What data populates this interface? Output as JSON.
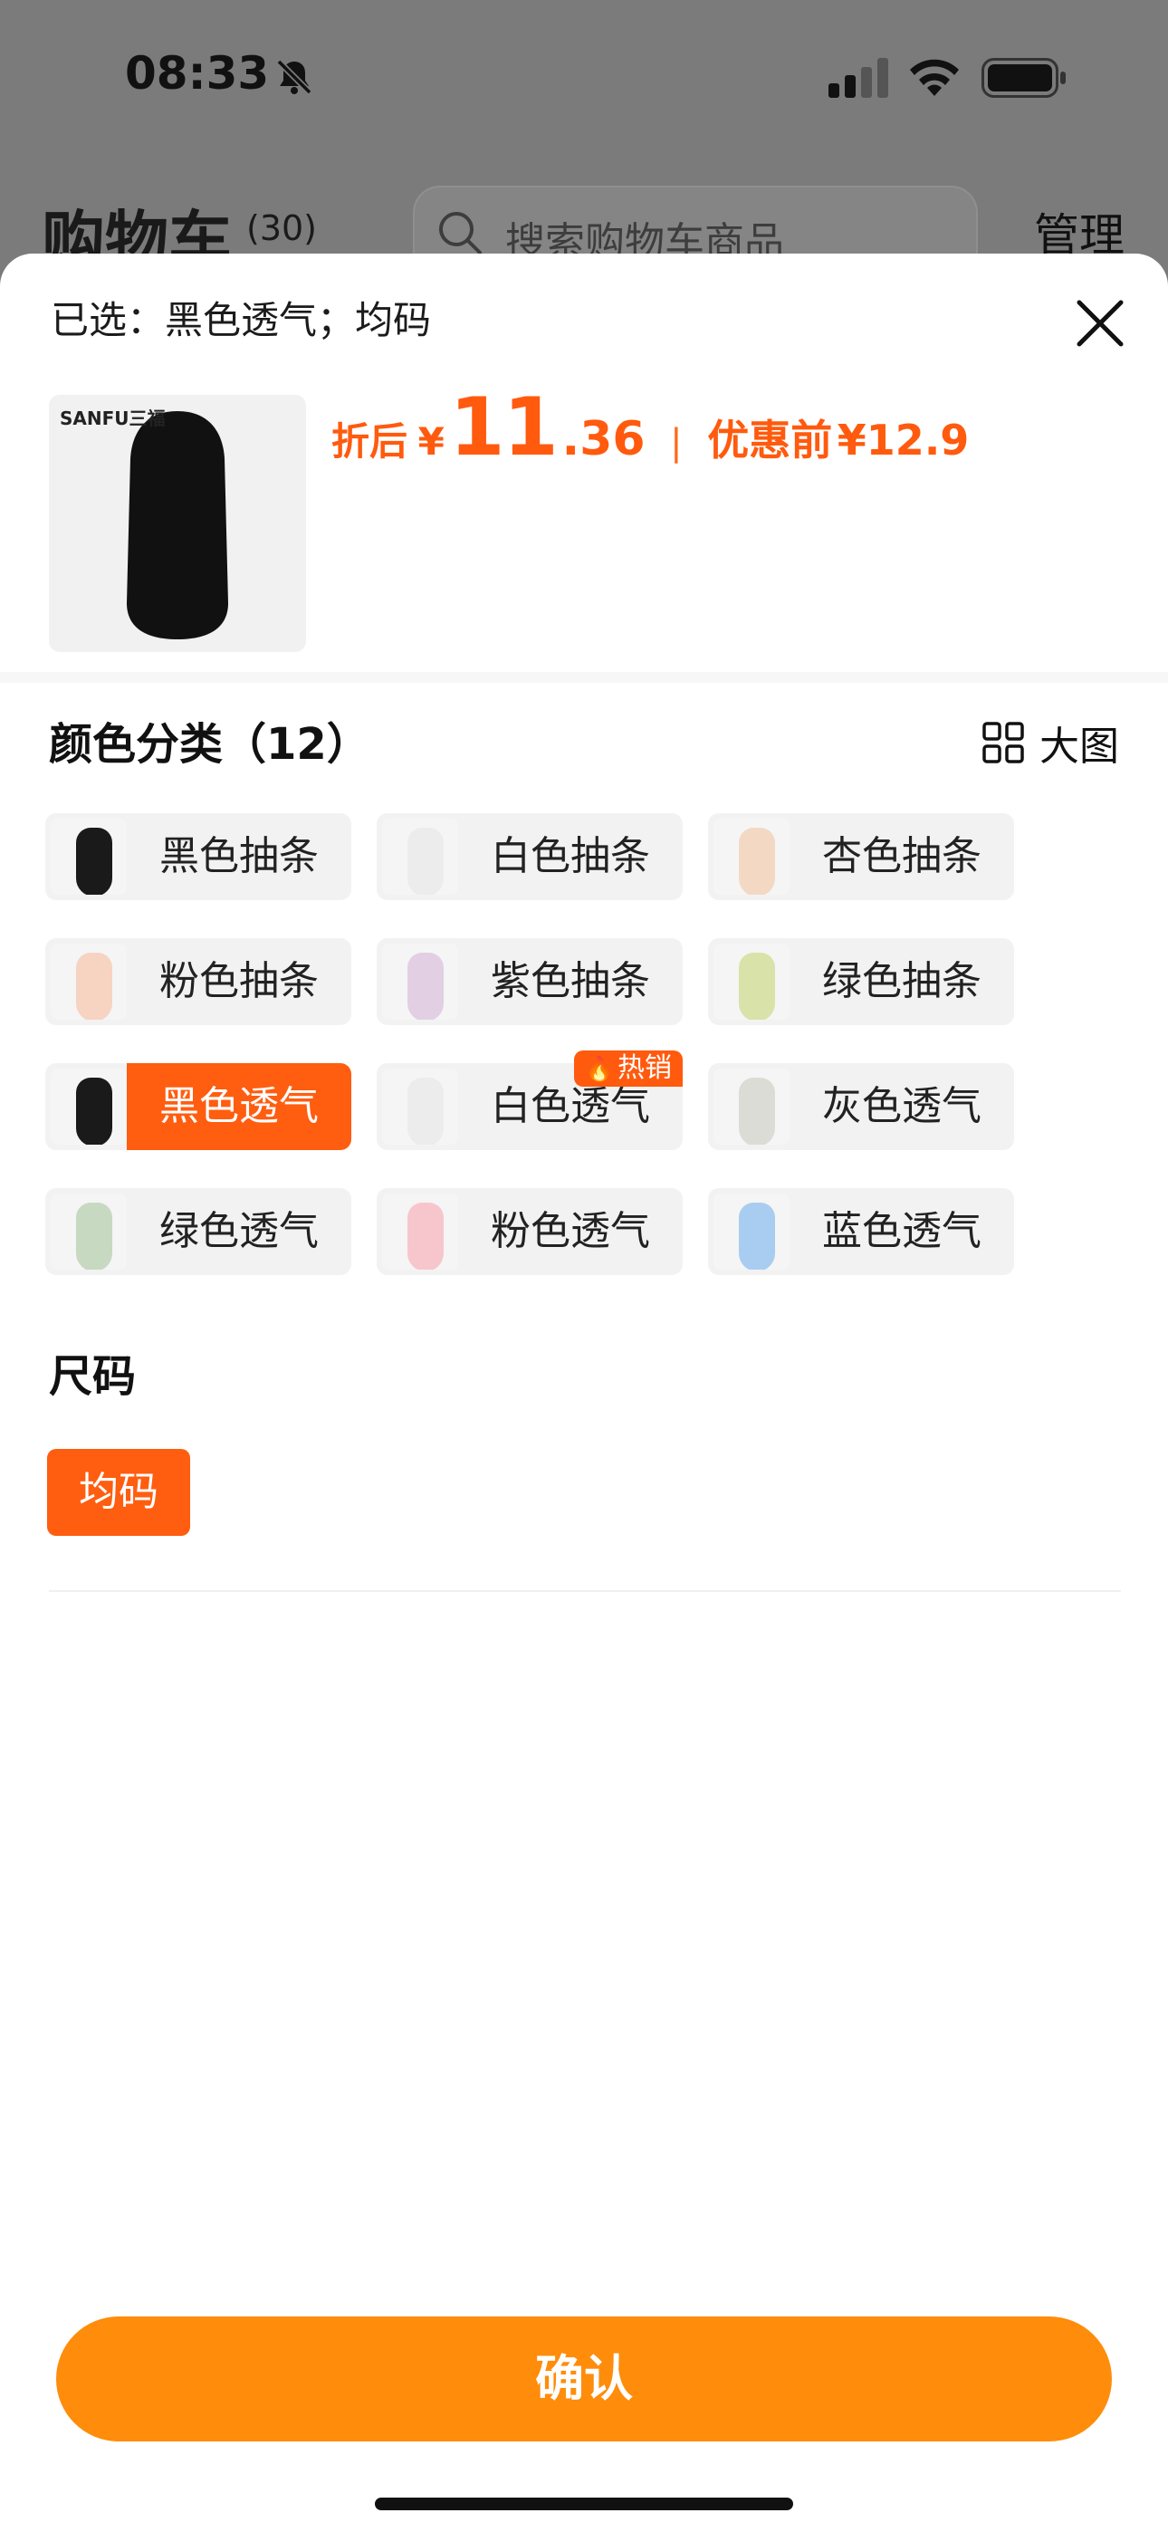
{
  "status_bar": {
    "time": "08:33"
  },
  "background": {
    "title": "购物车",
    "count": "(30)",
    "search_placeholder": "搜索购物车商品",
    "manage": "管理"
  },
  "sheet": {
    "selected": "已选：黑色透气；均码",
    "product": {
      "brand": "SANFU三福",
      "price_label": "折后",
      "currency": "¥",
      "price_int": "11",
      "price_dec": ".36",
      "separator": "|",
      "orig_label": "优惠前",
      "orig_price": "¥12.9"
    },
    "color_section": {
      "title": "颜色分类（12）",
      "big_pic_label": "大图",
      "options": [
        {
          "label": "黑色抽条",
          "swatch": "#1a1a1a",
          "selected": false,
          "badge": ""
        },
        {
          "label": "白色抽条",
          "swatch": "#ececec",
          "selected": false,
          "badge": ""
        },
        {
          "label": "杏色抽条",
          "swatch": "#f3d9c4",
          "selected": false,
          "badge": ""
        },
        {
          "label": "粉色抽条",
          "swatch": "#f7d3c2",
          "selected": false,
          "badge": ""
        },
        {
          "label": "紫色抽条",
          "swatch": "#e2cfe3",
          "selected": false,
          "badge": ""
        },
        {
          "label": "绿色抽条",
          "swatch": "#d9e2a8",
          "selected": false,
          "badge": ""
        },
        {
          "label": "黑色透气",
          "swatch": "#1a1a1a",
          "selected": true,
          "badge": ""
        },
        {
          "label": "白色透气",
          "swatch": "#ececec",
          "selected": false,
          "badge": "热销"
        },
        {
          "label": "灰色透气",
          "swatch": "#dcdcd6",
          "selected": false,
          "badge": ""
        },
        {
          "label": "绿色透气",
          "swatch": "#c7d9c1",
          "selected": false,
          "badge": ""
        },
        {
          "label": "粉色透气",
          "swatch": "#f7c6cc",
          "selected": false,
          "badge": ""
        },
        {
          "label": "蓝色透气",
          "swatch": "#a9cdf0",
          "selected": false,
          "badge": ""
        }
      ]
    },
    "size_section": {
      "title": "尺码",
      "options": [
        {
          "label": "均码",
          "selected": true
        }
      ]
    },
    "confirm_label": "确认"
  },
  "colors": {
    "accent": "#ff5d10",
    "confirm": "#ff8c0a"
  }
}
